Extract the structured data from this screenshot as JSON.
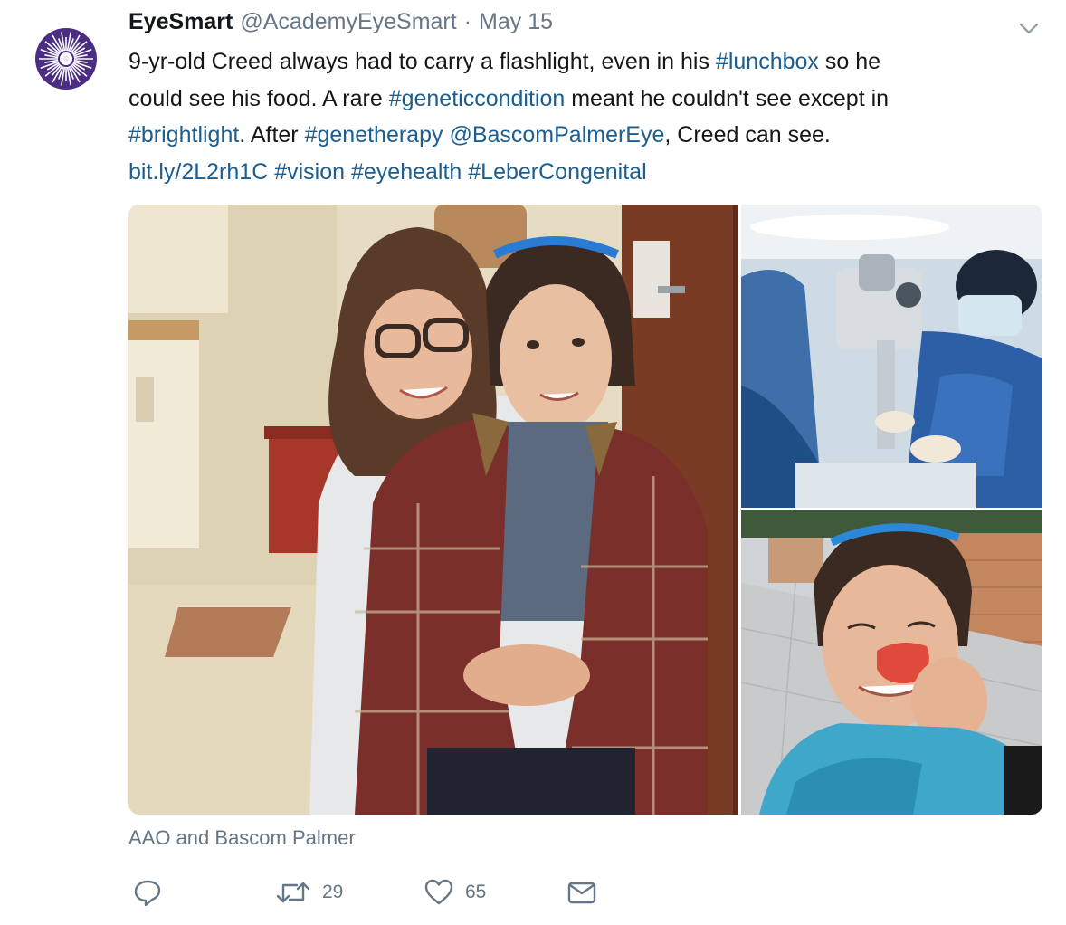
{
  "tweet": {
    "author": {
      "name": "EyeSmart",
      "handle": "@AcademyEyeSmart",
      "avatar_icon": "starburst-logo-icon"
    },
    "separator": "·",
    "date": "May 15",
    "text": {
      "line1": {
        "t1": "9-yr-old Creed always had to carry a flashlight, even in his ",
        "hashtag_lunchbox": "#lunchbox",
        "t2": " so he"
      },
      "line2": {
        "t1": "could see his food. A rare ",
        "hashtag_geneticcondition": "#geneticcondition",
        "t2": " meant he couldn't see except in"
      },
      "line3": {
        "hashtag_brightlight": "#brightlight",
        "t1": ". After ",
        "hashtag_genetherapy": "#genetherapy",
        "mention_bascom": "@BascomPalmerEye",
        "t2": ", Creed can see."
      },
      "line4": {
        "url": "bit.ly/2L2rh1C",
        "hashtag_vision": "#vision",
        "hashtag_eyehealth": "#eyehealth",
        "hashtag_lebercongenital": "#LeberCongenital"
      }
    },
    "media": {
      "photos": [
        "doctor-and-boy-photo",
        "surgery-photo",
        "boy-smiling-photo"
      ]
    },
    "media_credit": "AAO and Bascom Palmer",
    "actions": {
      "reply_icon": "reply-icon",
      "retweet_icon": "retweet-icon",
      "retweet_count": "29",
      "like_icon": "heart-icon",
      "like_count": "65",
      "dm_icon": "envelope-icon",
      "more_icon": "chevron-down-icon"
    },
    "colors": {
      "link": "#1b5e8f",
      "secondary_text": "#657786",
      "avatar_purple": "#4b2d83"
    }
  }
}
